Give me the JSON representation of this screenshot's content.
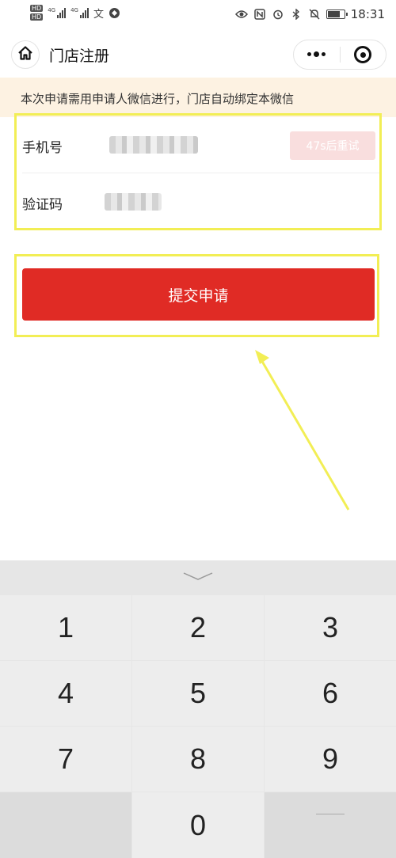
{
  "status_bar": {
    "hd_badges": [
      "HD",
      "HD"
    ],
    "net_labels": [
      "4G",
      "4G"
    ],
    "extra_glyph": "文",
    "time": "18:31"
  },
  "nav": {
    "title": "门店注册",
    "home_icon": "home-icon",
    "menu_icon": "more-dots-icon",
    "close_icon": "target-icon"
  },
  "notice": {
    "text": "本次申请需用申请人微信进行，门店自动绑定本微信"
  },
  "form": {
    "phone_label": "手机号",
    "code_label": "验证码",
    "retry_button": "47s后重试"
  },
  "submit": {
    "label": "提交申请"
  },
  "keypad": {
    "collapse_icon": "chevron-down-icon",
    "keys": [
      "1",
      "2",
      "3",
      "4",
      "5",
      "6",
      "7",
      "8",
      "9",
      "0"
    ],
    "delete_icon": "backspace-icon"
  },
  "colors": {
    "primary_red": "#e02b25",
    "notice_bg": "#fdf2e2",
    "highlight_yellow": "#f2ee55",
    "disabled_button": "#f9dede"
  }
}
